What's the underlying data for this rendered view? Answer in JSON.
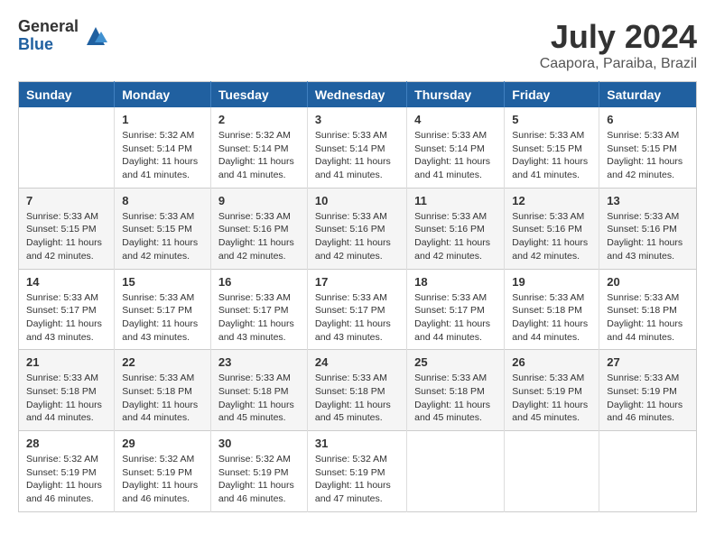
{
  "logo": {
    "general": "General",
    "blue": "Blue"
  },
  "title": "July 2024",
  "location": "Caapora, Paraiba, Brazil",
  "weekdays": [
    "Sunday",
    "Monday",
    "Tuesday",
    "Wednesday",
    "Thursday",
    "Friday",
    "Saturday"
  ],
  "weeks": [
    [
      {
        "day": "",
        "sunrise": "",
        "sunset": "",
        "daylight": ""
      },
      {
        "day": "1",
        "sunrise": "Sunrise: 5:32 AM",
        "sunset": "Sunset: 5:14 PM",
        "daylight": "Daylight: 11 hours and 41 minutes."
      },
      {
        "day": "2",
        "sunrise": "Sunrise: 5:32 AM",
        "sunset": "Sunset: 5:14 PM",
        "daylight": "Daylight: 11 hours and 41 minutes."
      },
      {
        "day": "3",
        "sunrise": "Sunrise: 5:33 AM",
        "sunset": "Sunset: 5:14 PM",
        "daylight": "Daylight: 11 hours and 41 minutes."
      },
      {
        "day": "4",
        "sunrise": "Sunrise: 5:33 AM",
        "sunset": "Sunset: 5:14 PM",
        "daylight": "Daylight: 11 hours and 41 minutes."
      },
      {
        "day": "5",
        "sunrise": "Sunrise: 5:33 AM",
        "sunset": "Sunset: 5:15 PM",
        "daylight": "Daylight: 11 hours and 41 minutes."
      },
      {
        "day": "6",
        "sunrise": "Sunrise: 5:33 AM",
        "sunset": "Sunset: 5:15 PM",
        "daylight": "Daylight: 11 hours and 42 minutes."
      }
    ],
    [
      {
        "day": "7",
        "sunrise": "Sunrise: 5:33 AM",
        "sunset": "Sunset: 5:15 PM",
        "daylight": "Daylight: 11 hours and 42 minutes."
      },
      {
        "day": "8",
        "sunrise": "Sunrise: 5:33 AM",
        "sunset": "Sunset: 5:15 PM",
        "daylight": "Daylight: 11 hours and 42 minutes."
      },
      {
        "day": "9",
        "sunrise": "Sunrise: 5:33 AM",
        "sunset": "Sunset: 5:16 PM",
        "daylight": "Daylight: 11 hours and 42 minutes."
      },
      {
        "day": "10",
        "sunrise": "Sunrise: 5:33 AM",
        "sunset": "Sunset: 5:16 PM",
        "daylight": "Daylight: 11 hours and 42 minutes."
      },
      {
        "day": "11",
        "sunrise": "Sunrise: 5:33 AM",
        "sunset": "Sunset: 5:16 PM",
        "daylight": "Daylight: 11 hours and 42 minutes."
      },
      {
        "day": "12",
        "sunrise": "Sunrise: 5:33 AM",
        "sunset": "Sunset: 5:16 PM",
        "daylight": "Daylight: 11 hours and 42 minutes."
      },
      {
        "day": "13",
        "sunrise": "Sunrise: 5:33 AM",
        "sunset": "Sunset: 5:16 PM",
        "daylight": "Daylight: 11 hours and 43 minutes."
      }
    ],
    [
      {
        "day": "14",
        "sunrise": "Sunrise: 5:33 AM",
        "sunset": "Sunset: 5:17 PM",
        "daylight": "Daylight: 11 hours and 43 minutes."
      },
      {
        "day": "15",
        "sunrise": "Sunrise: 5:33 AM",
        "sunset": "Sunset: 5:17 PM",
        "daylight": "Daylight: 11 hours and 43 minutes."
      },
      {
        "day": "16",
        "sunrise": "Sunrise: 5:33 AM",
        "sunset": "Sunset: 5:17 PM",
        "daylight": "Daylight: 11 hours and 43 minutes."
      },
      {
        "day": "17",
        "sunrise": "Sunrise: 5:33 AM",
        "sunset": "Sunset: 5:17 PM",
        "daylight": "Daylight: 11 hours and 43 minutes."
      },
      {
        "day": "18",
        "sunrise": "Sunrise: 5:33 AM",
        "sunset": "Sunset: 5:17 PM",
        "daylight": "Daylight: 11 hours and 44 minutes."
      },
      {
        "day": "19",
        "sunrise": "Sunrise: 5:33 AM",
        "sunset": "Sunset: 5:18 PM",
        "daylight": "Daylight: 11 hours and 44 minutes."
      },
      {
        "day": "20",
        "sunrise": "Sunrise: 5:33 AM",
        "sunset": "Sunset: 5:18 PM",
        "daylight": "Daylight: 11 hours and 44 minutes."
      }
    ],
    [
      {
        "day": "21",
        "sunrise": "Sunrise: 5:33 AM",
        "sunset": "Sunset: 5:18 PM",
        "daylight": "Daylight: 11 hours and 44 minutes."
      },
      {
        "day": "22",
        "sunrise": "Sunrise: 5:33 AM",
        "sunset": "Sunset: 5:18 PM",
        "daylight": "Daylight: 11 hours and 44 minutes."
      },
      {
        "day": "23",
        "sunrise": "Sunrise: 5:33 AM",
        "sunset": "Sunset: 5:18 PM",
        "daylight": "Daylight: 11 hours and 45 minutes."
      },
      {
        "day": "24",
        "sunrise": "Sunrise: 5:33 AM",
        "sunset": "Sunset: 5:18 PM",
        "daylight": "Daylight: 11 hours and 45 minutes."
      },
      {
        "day": "25",
        "sunrise": "Sunrise: 5:33 AM",
        "sunset": "Sunset: 5:18 PM",
        "daylight": "Daylight: 11 hours and 45 minutes."
      },
      {
        "day": "26",
        "sunrise": "Sunrise: 5:33 AM",
        "sunset": "Sunset: 5:19 PM",
        "daylight": "Daylight: 11 hours and 45 minutes."
      },
      {
        "day": "27",
        "sunrise": "Sunrise: 5:33 AM",
        "sunset": "Sunset: 5:19 PM",
        "daylight": "Daylight: 11 hours and 46 minutes."
      }
    ],
    [
      {
        "day": "28",
        "sunrise": "Sunrise: 5:32 AM",
        "sunset": "Sunset: 5:19 PM",
        "daylight": "Daylight: 11 hours and 46 minutes."
      },
      {
        "day": "29",
        "sunrise": "Sunrise: 5:32 AM",
        "sunset": "Sunset: 5:19 PM",
        "daylight": "Daylight: 11 hours and 46 minutes."
      },
      {
        "day": "30",
        "sunrise": "Sunrise: 5:32 AM",
        "sunset": "Sunset: 5:19 PM",
        "daylight": "Daylight: 11 hours and 46 minutes."
      },
      {
        "day": "31",
        "sunrise": "Sunrise: 5:32 AM",
        "sunset": "Sunset: 5:19 PM",
        "daylight": "Daylight: 11 hours and 47 minutes."
      },
      {
        "day": "",
        "sunrise": "",
        "sunset": "",
        "daylight": ""
      },
      {
        "day": "",
        "sunrise": "",
        "sunset": "",
        "daylight": ""
      },
      {
        "day": "",
        "sunrise": "",
        "sunset": "",
        "daylight": ""
      }
    ]
  ]
}
